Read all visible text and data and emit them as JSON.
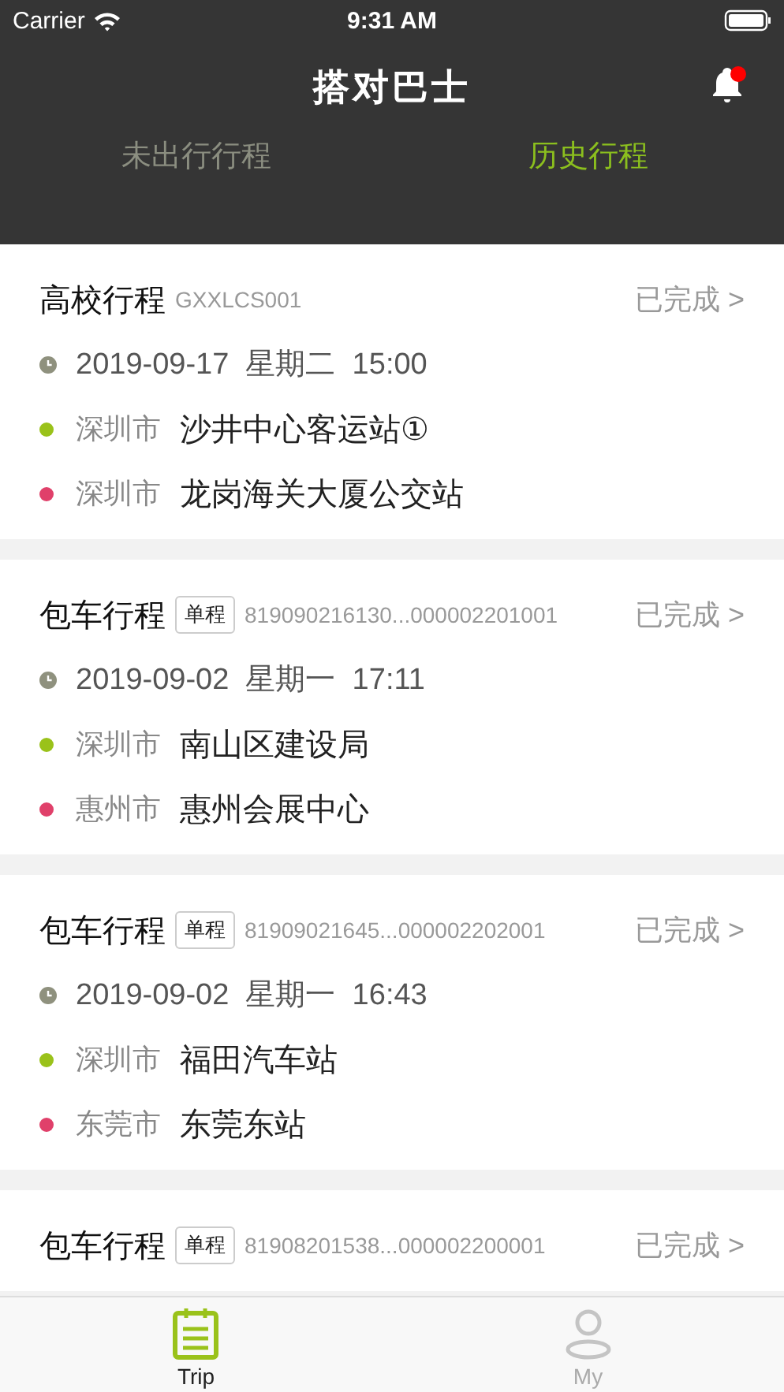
{
  "status_bar": {
    "carrier": "Carrier",
    "time": "9:31 AM"
  },
  "header": {
    "title": "搭对巴士",
    "notification_dot": true
  },
  "tabs": [
    {
      "label": "未出行行程",
      "selected": false
    },
    {
      "label": "历史行程",
      "selected": true
    }
  ],
  "trips": [
    {
      "title": "高校行程",
      "code": "GXXLCS001",
      "status": "已完成 >",
      "date": "2019-09-17  星期二  15:00",
      "stops": [
        {
          "city": "深圳市",
          "place": "沙井中心客运站①",
          "kind": "start"
        },
        {
          "city": "深圳市",
          "place": "龙岗海关大厦公交站",
          "kind": "end"
        }
      ]
    },
    {
      "title": "包车行程",
      "tag": "单程",
      "code": "819090216130...000002201001",
      "status": "已完成 >",
      "date": "2019-09-02  星期一  17:11",
      "stops": [
        {
          "city": "深圳市",
          "place": "南山区建设局",
          "kind": "start"
        },
        {
          "city": "惠州市",
          "place": "惠州会展中心",
          "kind": "end"
        }
      ]
    },
    {
      "title": "包车行程",
      "tag": "单程",
      "code": "81909021645...000002202001",
      "status": "已完成 >",
      "date": "2019-09-02  星期一  16:43",
      "stops": [
        {
          "city": "深圳市",
          "place": "福田汽车站",
          "kind": "start"
        },
        {
          "city": "东莞市",
          "place": "东莞东站",
          "kind": "end"
        }
      ]
    },
    {
      "title": "包车行程",
      "tag": "单程",
      "code": "81908201538...000002200001",
      "status": "已完成 >"
    }
  ],
  "tab_bar": [
    {
      "label": "Trip",
      "kind": "trip",
      "selected": true
    },
    {
      "label": "My",
      "kind": "my",
      "selected": false
    }
  ]
}
